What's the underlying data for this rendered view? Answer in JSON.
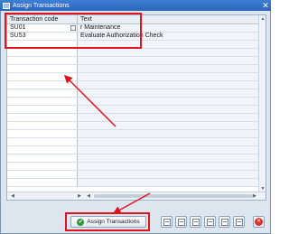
{
  "window": {
    "title": "Assign Transactions"
  },
  "grid": {
    "columns": [
      "Transaction code",
      "Text"
    ],
    "rows": [
      {
        "code": "SU01",
        "text": "r Maintenance"
      },
      {
        "code": "SU53",
        "text": "Evaluate Authorization Check"
      }
    ]
  },
  "footer": {
    "assign_label": "Assign Transactions"
  },
  "colors": {
    "highlight": "#e0141e",
    "title_bar": "#2a65b8",
    "ok_green": "#2f9a3a",
    "cancel_red": "#d8322b"
  },
  "icons": [
    "app-window-icon",
    "close-icon",
    "f4-help-icon",
    "ok-check-icon",
    "table-tool-icon",
    "cancel-icon"
  ]
}
